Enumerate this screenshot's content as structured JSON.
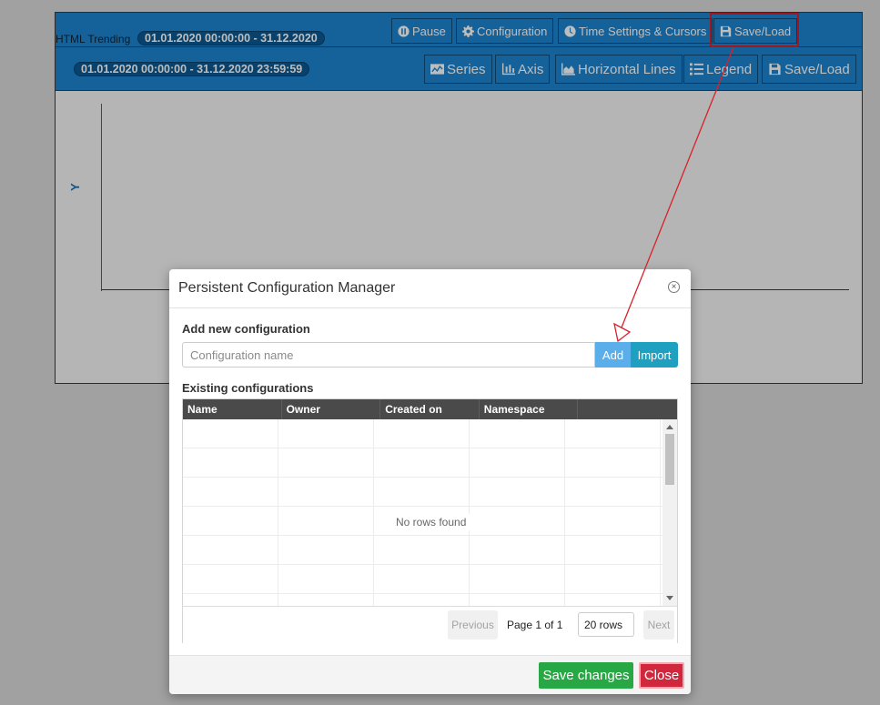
{
  "trend": {
    "title": "HTML Trending",
    "range_short": "01.01.2020 00:00:00 - 31.12.2020",
    "range_full": "01.01.2020 00:00:00 - 31.12.2020 23:59:59",
    "y_axis_label": "Y",
    "toolbar_top": [
      {
        "label": "Pause",
        "icon": "pause-icon"
      },
      {
        "label": "Configuration",
        "icon": "gear-icon"
      },
      {
        "label": "Time Settings & Cursors",
        "icon": "clock-icon"
      },
      {
        "label": "Save/Load",
        "icon": "floppy-icon"
      }
    ],
    "toolbar_bottom": [
      {
        "label": "Series",
        "icon": "chart-icon"
      },
      {
        "label": "Axis",
        "icon": "axis-icon"
      },
      {
        "label": "Horizontal Lines",
        "icon": "area-chart-icon"
      },
      {
        "label": "Legend",
        "icon": "list-icon"
      },
      {
        "label": "Save/Load",
        "icon": "floppy-icon"
      }
    ]
  },
  "modal": {
    "title": "Persistent Configuration Manager",
    "add_section_label": "Add new configuration",
    "name_placeholder": "Configuration name",
    "add_label": "Add",
    "import_label": "Import",
    "existing_label": "Existing configurations",
    "columns": [
      "Name",
      "Owner",
      "Created on",
      "Namespace",
      ""
    ],
    "empty_message": "No rows found",
    "pager": {
      "previous": "Previous",
      "info": "Page 1 of 1",
      "rows": "20 rows",
      "next": "Next"
    },
    "save_label": "Save changes",
    "close_label": "Close"
  },
  "colors": {
    "toolbar_blue": "#1d85d0",
    "highlight_red": "#d8212b",
    "save_green": "#28a745",
    "close_red": "#d0273d",
    "add_blue": "#5aaeea",
    "import_teal": "#1fa0c0"
  }
}
